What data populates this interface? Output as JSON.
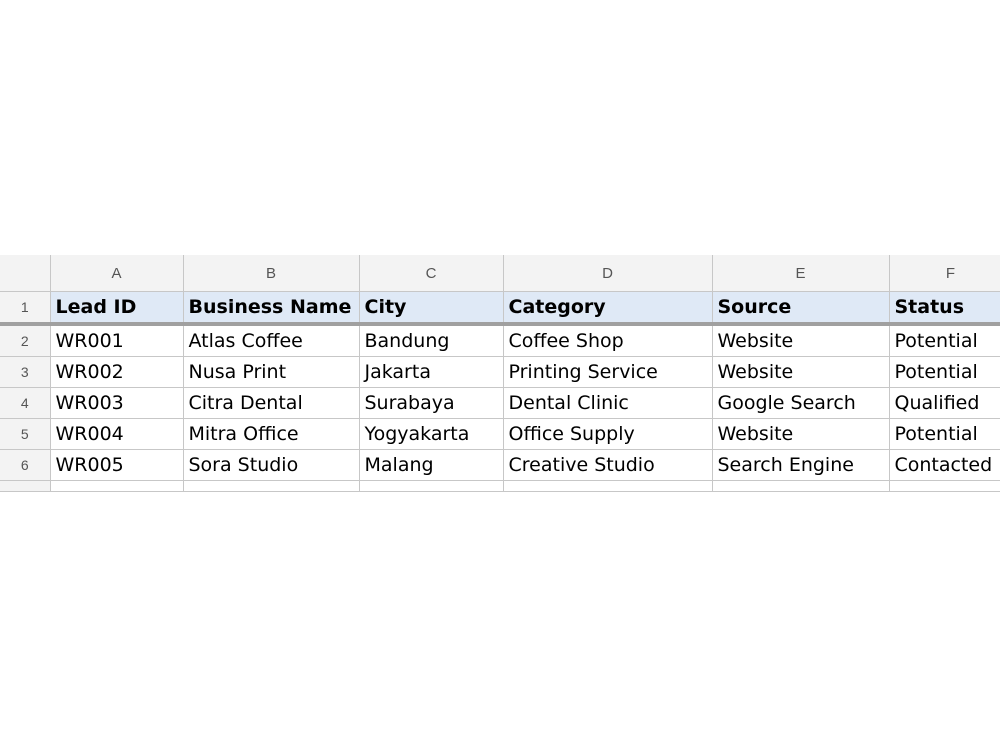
{
  "spreadsheet": {
    "column_headers": [
      "A",
      "B",
      "C",
      "D",
      "E",
      "F"
    ],
    "row_numbers": [
      "1",
      "2",
      "3",
      "4",
      "5",
      "6"
    ],
    "header": [
      "Lead ID",
      "Business Name",
      "City",
      "Category",
      "Source",
      "Status"
    ],
    "rows": [
      [
        "WR001",
        "Atlas Coffee",
        "Bandung",
        "Coffee Shop",
        "Website",
        "Potential"
      ],
      [
        "WR002",
        "Nusa Print",
        "Jakarta",
        "Printing Service",
        "Website",
        "Potential"
      ],
      [
        "WR003",
        "Citra Dental",
        "Surabaya",
        "Dental Clinic",
        "Google Search",
        "Qualified"
      ],
      [
        "WR004",
        "Mitra Office",
        "Yogyakarta",
        "Office Supply",
        "Website",
        "Potential"
      ],
      [
        "WR005",
        "Sora Studio",
        "Malang",
        "Creative Studio",
        "Search Engine",
        "Contacted"
      ]
    ],
    "colors": {
      "header_fill": "#dfe9f6",
      "gridline": "#c7c7c7",
      "header_bg": "#f3f3f3",
      "frozen_divider": "#a0a0a0"
    }
  }
}
